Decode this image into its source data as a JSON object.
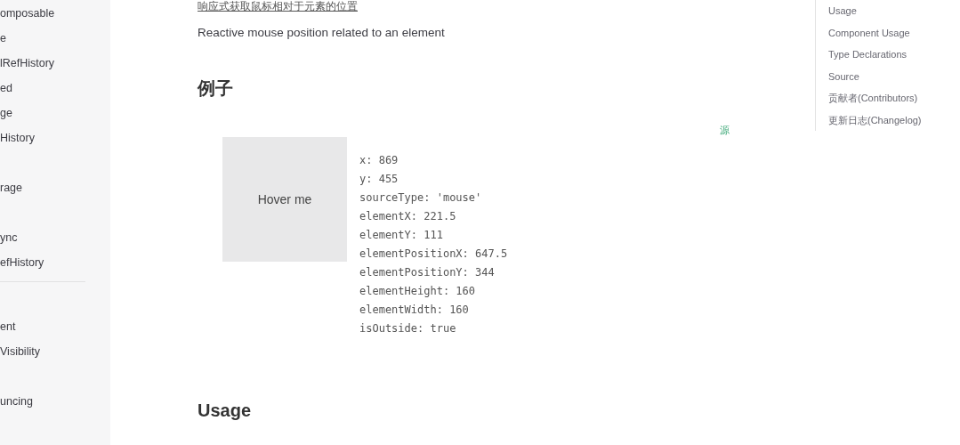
{
  "sidebar": {
    "sections": [
      {
        "groups": [
          [
            "omposable",
            "e",
            "lRefHistory",
            "ed",
            "ge",
            "History"
          ],
          [
            "rage"
          ],
          [
            "ync",
            "efHistory"
          ]
        ]
      },
      {
        "groups": [
          [
            "ent",
            "Visibility"
          ],
          [
            "uncing"
          ]
        ]
      }
    ]
  },
  "content": {
    "subtitle": "响应式获取鼠标相对于元素的位置",
    "description": "Reactive mouse position related to an element",
    "example_heading": "例子",
    "source_link": "源",
    "demo": {
      "target_label": "Hover me",
      "output": [
        "x: 869",
        "y: 455",
        "sourceType: 'mouse'",
        "elementX: 221.5",
        "elementY: 111",
        "elementPositionX: 647.5",
        "elementPositionY: 344",
        "elementHeight: 160",
        "elementWidth: 160",
        "isOutside: true"
      ]
    },
    "usage_heading": "Usage"
  },
  "toc": {
    "items": [
      "Usage",
      "Component Usage",
      "Type Declarations",
      "Source",
      "贡献者(Contributors)",
      "更新日志(Changelog)"
    ]
  }
}
